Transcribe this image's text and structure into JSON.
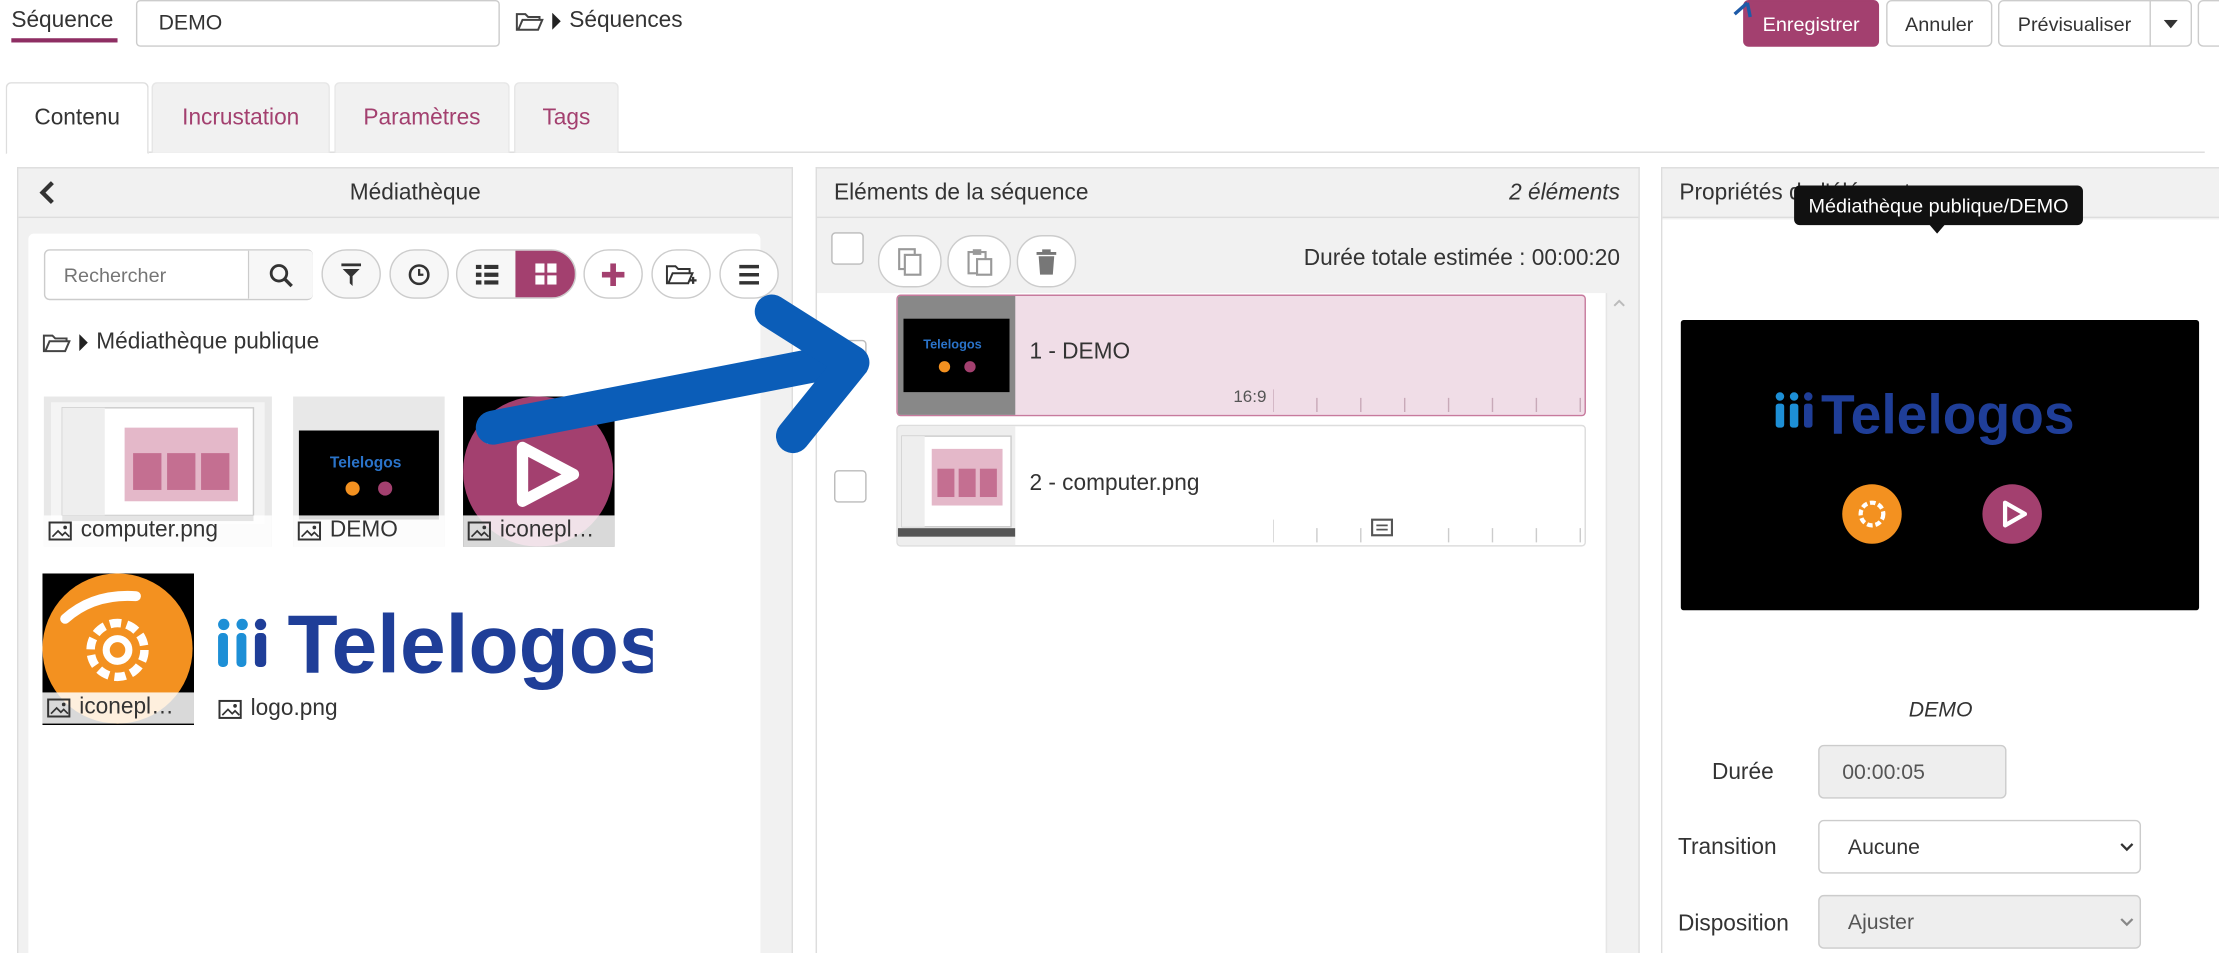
{
  "header": {
    "label": "Séquence",
    "name_value": "DEMO",
    "breadcrumb": "Séquences",
    "save_label": "Enregistrer",
    "cancel_label": "Annuler",
    "preview_label": "Prévisualiser"
  },
  "tabs": [
    {
      "label": "Contenu"
    },
    {
      "label": "Incrustation"
    },
    {
      "label": "Paramètres"
    },
    {
      "label": "Tags"
    }
  ],
  "media": {
    "title": "Médiathèque",
    "search_placeholder": "Rechercher",
    "folder": "Médiathèque publique",
    "items": [
      {
        "label": "computer.png"
      },
      {
        "label": "DEMO"
      },
      {
        "label": "iconepl…"
      },
      {
        "label": "iconepl…"
      },
      {
        "label": "logo.png"
      }
    ]
  },
  "sequence": {
    "title": "Eléments de la séquence",
    "count": "2  éléments",
    "total": "Durée totale estimée : 00:00:20",
    "items": [
      {
        "label": "1 -  DEMO",
        "ratio": "16:9"
      },
      {
        "label": "2 -  computer.png"
      }
    ]
  },
  "properties": {
    "title": "Propriétés de l'élément",
    "tooltip": "Médiathèque publique/DEMO",
    "preview_logo": "Telelogos",
    "name": "DEMO",
    "duration_label": "Durée",
    "duration_value": "00:00:05",
    "transition_label": "Transition",
    "transition_value": "Aucune",
    "layout_label": "Disposition",
    "layout_value": "Ajuster"
  },
  "logo_text": "Telelogos",
  "logo_small": "Telelogos",
  "colors": {
    "accent": "#a3406f",
    "highlight_row": "#f0dde7",
    "arrow": "#0b5db8",
    "logo_blue": "#1f3e98",
    "logo_light": "#1d8fd6",
    "orange": "#f39120"
  }
}
